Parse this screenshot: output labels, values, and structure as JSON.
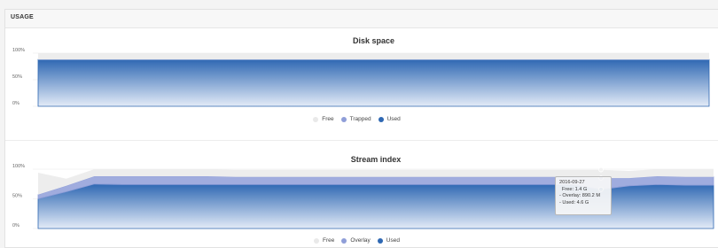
{
  "panel": {
    "header": "USAGE"
  },
  "chart_data": [
    {
      "type": "area",
      "title": "Disk space",
      "ylim": [
        0,
        100
      ],
      "y_ticks": [
        "100%",
        "50%",
        "0%"
      ],
      "stacked": true,
      "x_count": 2,
      "series": [
        {
          "name": "Free",
          "color": "#d9d9d9",
          "values": [
            12,
            12
          ]
        },
        {
          "name": "Trapped",
          "color": "#8f9ed8",
          "values": [
            0,
            0
          ]
        },
        {
          "name": "Used",
          "color": "#2f68b3",
          "values": [
            88,
            88
          ]
        }
      ],
      "legend": "bottom"
    },
    {
      "type": "area",
      "title": "Stream index",
      "ylim": [
        0,
        100
      ],
      "y_ticks": [
        "100%",
        "50%",
        "0%"
      ],
      "stacked": true,
      "x": [
        "2016-09-27"
      ],
      "series": [
        {
          "name": "Free",
          "color": "#d9d9d9",
          "values": [
            37,
            12,
            12,
            12,
            12,
            12,
            12,
            12,
            12,
            12,
            12,
            12,
            12,
            12,
            12,
            12,
            12,
            12,
            12,
            12,
            14,
            12,
            12,
            13,
            13
          ]
        },
        {
          "name": "Overlay",
          "color": "#8f9ed8",
          "values": [
            7,
            10,
            13,
            14,
            14,
            14,
            14,
            13,
            13,
            13,
            13,
            13,
            13,
            13,
            13,
            13,
            13,
            13,
            13,
            13,
            19,
            13,
            14,
            14,
            14
          ]
        },
        {
          "name": "Used",
          "color": "#2f68b3",
          "values": [
            50,
            62,
            75,
            74,
            74,
            74,
            74,
            74,
            74,
            74,
            74,
            74,
            74,
            74,
            74,
            74,
            74,
            74,
            74,
            74,
            66,
            72,
            74,
            73,
            73
          ]
        }
      ],
      "legend": "bottom",
      "tooltip": {
        "date": "2016-09-27",
        "lines": [
          "Free: 1.4 G",
          "- Overlay: 890.2 M",
          "- Used: 4.6 G"
        ]
      }
    }
  ]
}
